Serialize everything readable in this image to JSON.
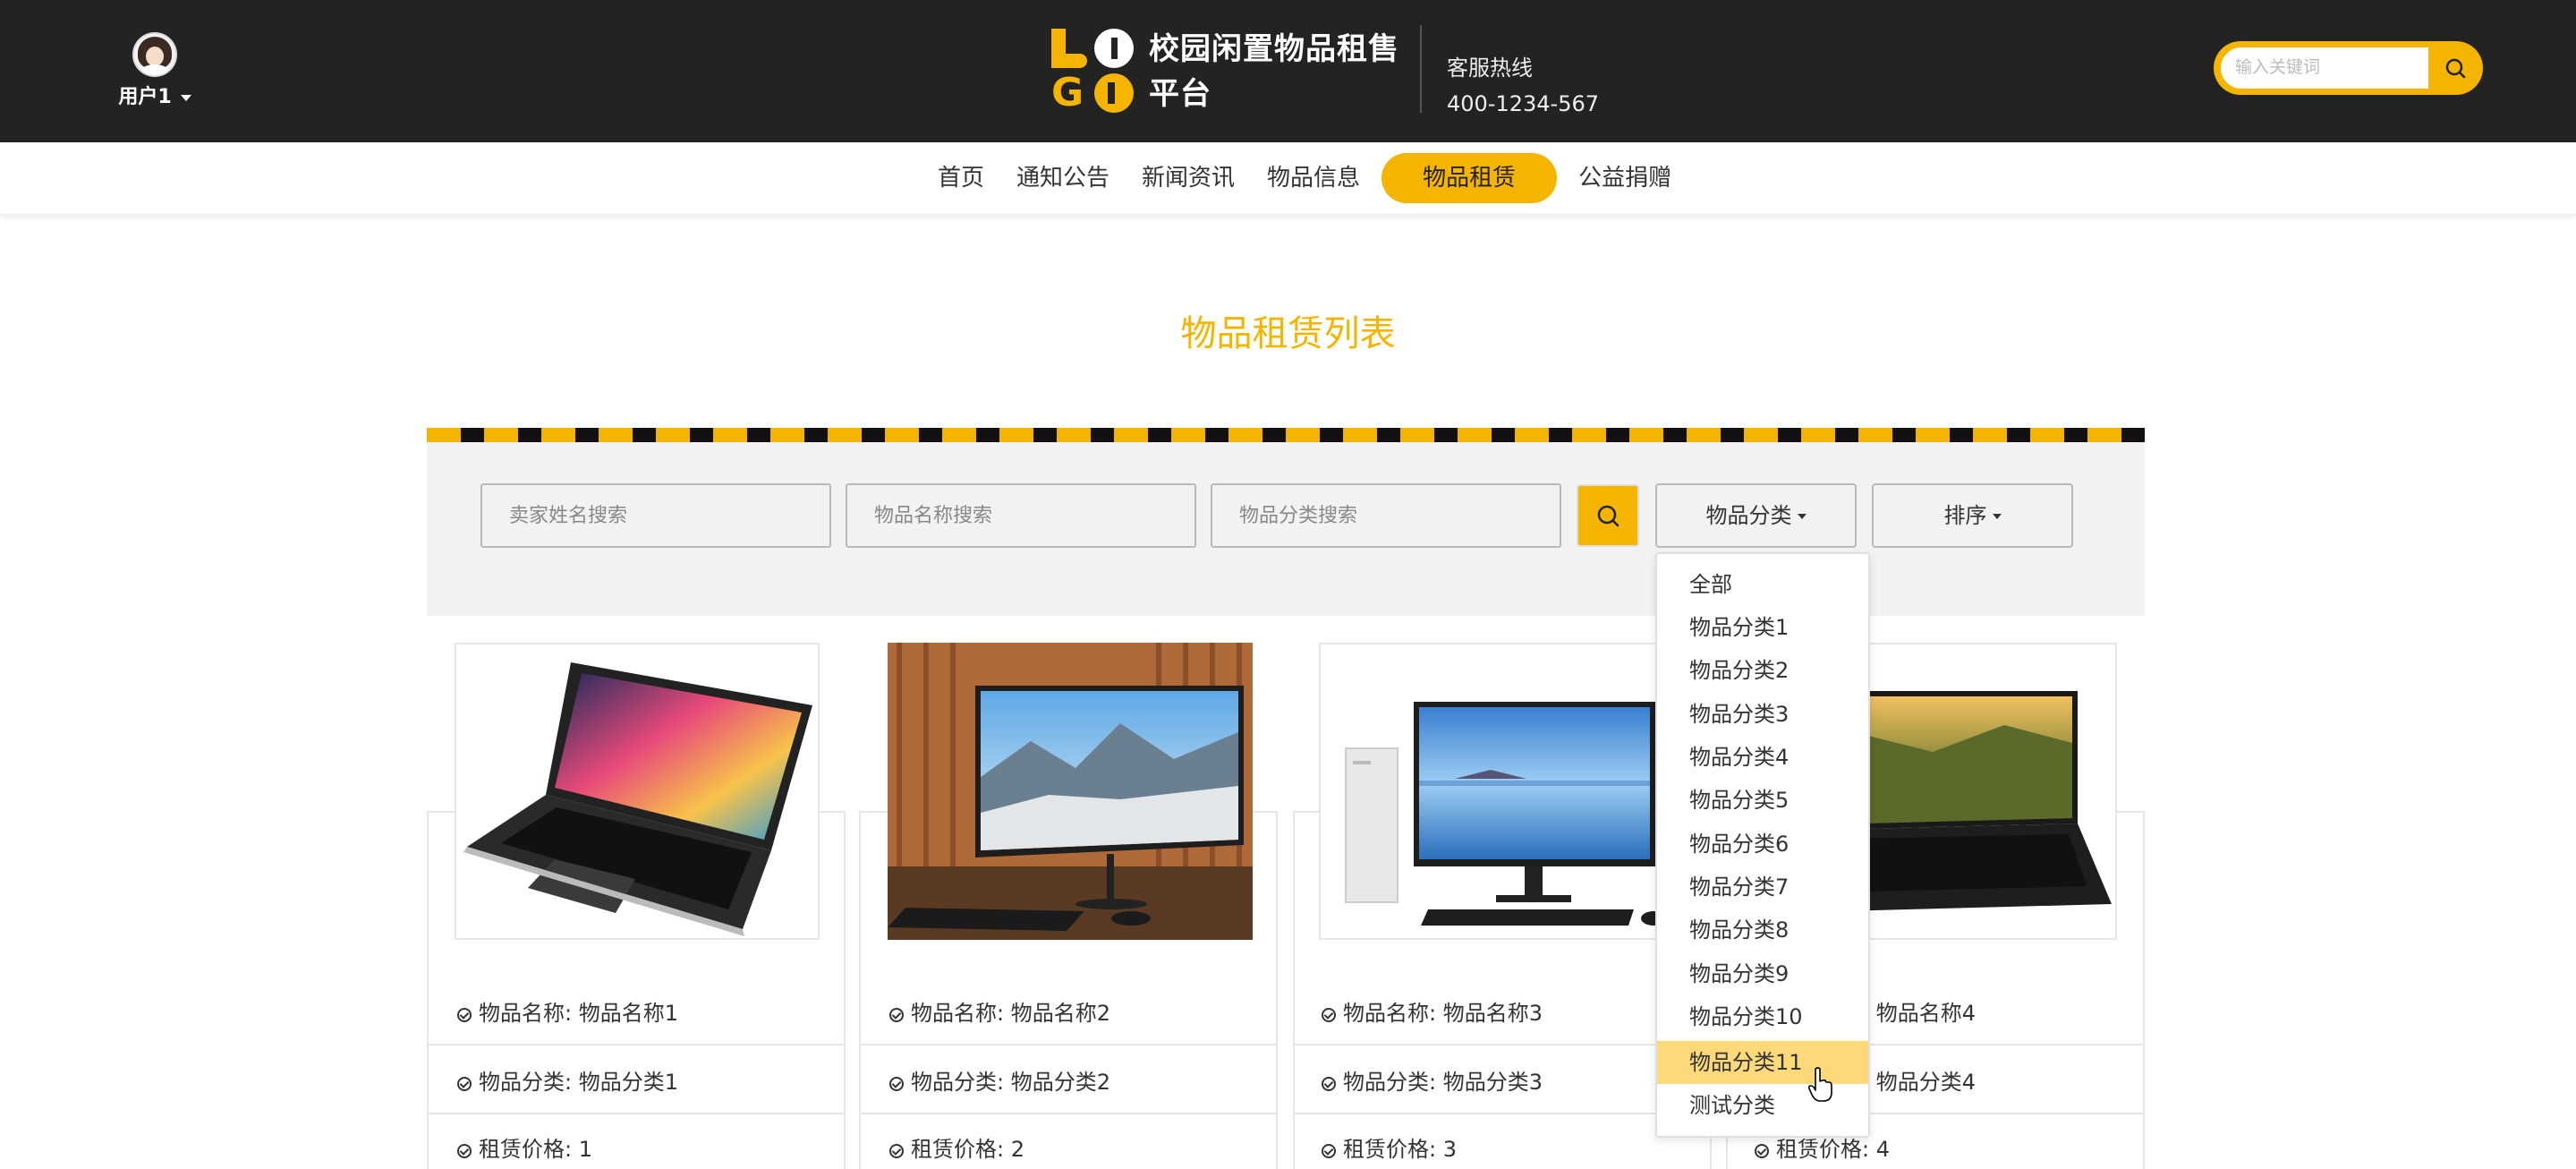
{
  "header": {
    "user_name": "用户1",
    "site_title": "校园闲置物品租售平台",
    "hotline_label": "客服热线",
    "hotline_number": "400-1234-567",
    "search_placeholder": "输入关键词"
  },
  "nav": {
    "items": [
      {
        "label": "首页"
      },
      {
        "label": "通知公告"
      },
      {
        "label": "新闻资讯"
      },
      {
        "label": "物品信息"
      },
      {
        "label": "物品租赁",
        "active": true
      },
      {
        "label": "公益捐赠"
      }
    ]
  },
  "main": {
    "title": "物品租赁列表",
    "filters": {
      "seller_placeholder": "卖家姓名搜索",
      "name_placeholder": "物品名称搜索",
      "category_placeholder": "物品分类搜索",
      "category_button": "物品分类",
      "sort_button": "排序"
    },
    "category_menu": [
      "全部",
      "物品分类1",
      "物品分类2",
      "物品分类3",
      "物品分类4",
      "物品分类5",
      "物品分类6",
      "物品分类7",
      "物品分类8",
      "物品分类9",
      "物品分类10",
      "物品分类11",
      "测试分类"
    ],
    "highlighted_menu_item": "物品分类11",
    "products": [
      {
        "name": "物品名称: 物品名称1",
        "category": "物品分类: 物品分类1",
        "price": "租赁价格: 1",
        "image": "laptop-icon"
      },
      {
        "name": "物品名称: 物品名称2",
        "category": "物品分类: 物品分类2",
        "price": "租赁价格: 2",
        "image": "monitor-icon"
      },
      {
        "name": "物品名称: 物品名称3",
        "category": "物品分类: 物品分类3",
        "price": "租赁价格: 3",
        "image": "desktop-icon"
      },
      {
        "name": "物品名称: 物品名称4",
        "category": "物品分类: 物品分类4",
        "price": "租赁价格: 4",
        "image": "laptop-icon"
      }
    ]
  },
  "colors": {
    "accent": "#f5b400",
    "header_bg": "#232323",
    "highlight": "#fdd97a"
  }
}
